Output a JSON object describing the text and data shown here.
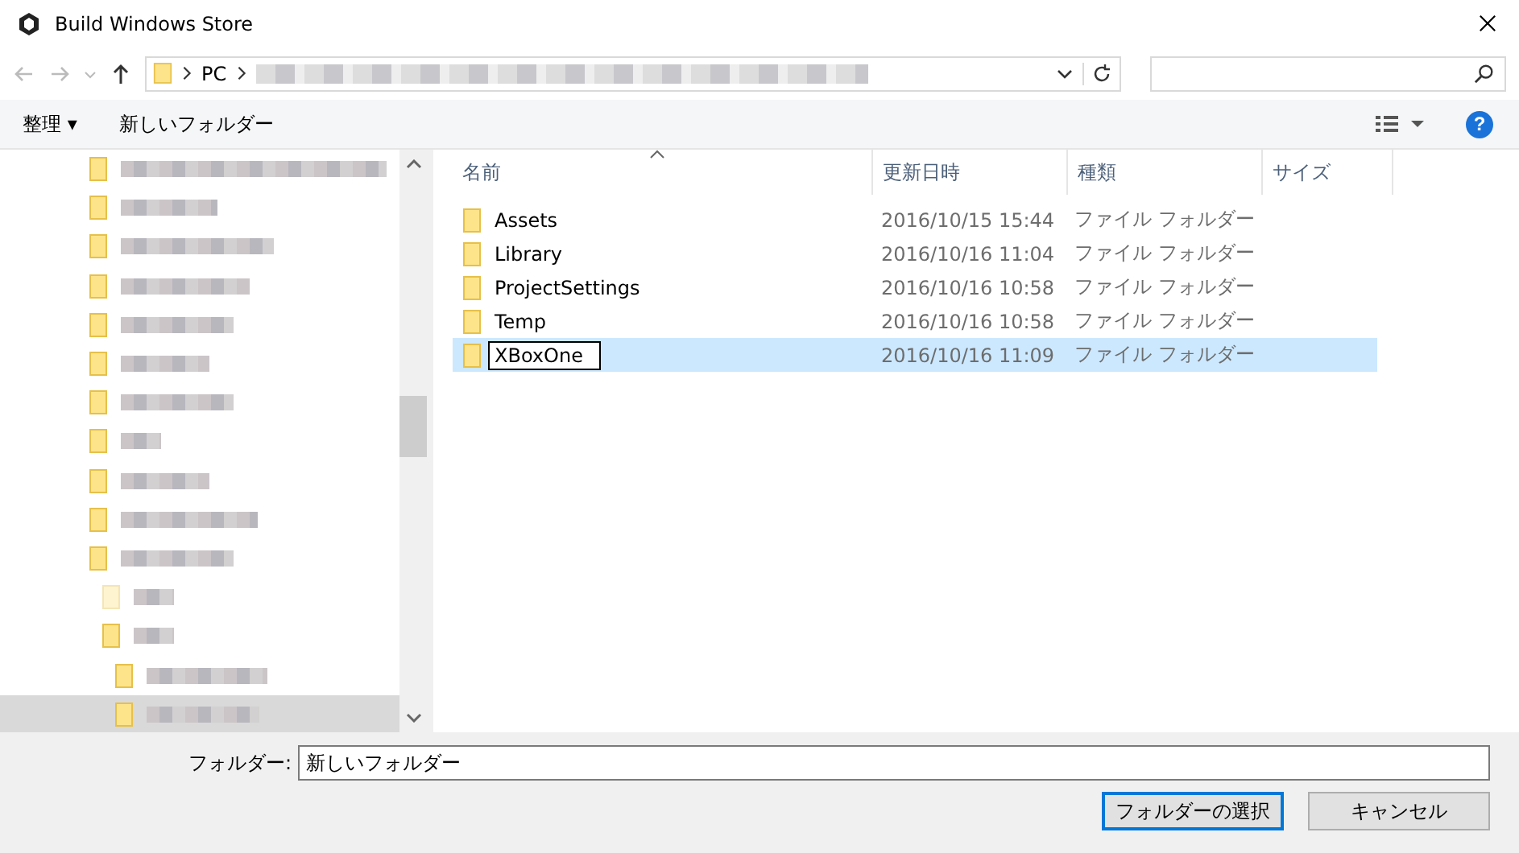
{
  "window": {
    "title": "Build Windows Store"
  },
  "address": {
    "segments": [
      "PC"
    ]
  },
  "toolbar": {
    "organize": "整理 ▾",
    "new_folder": "新しいフォルダー",
    "help": "?"
  },
  "tree": [
    {
      "selected": false,
      "dimmed": false
    },
    {
      "selected": false,
      "dimmed": false
    },
    {
      "selected": false,
      "dimmed": false
    },
    {
      "selected": false,
      "dimmed": false
    },
    {
      "selected": false,
      "dimmed": false
    },
    {
      "selected": false,
      "dimmed": false
    },
    {
      "selected": false,
      "dimmed": false
    },
    {
      "selected": false,
      "dimmed": false
    },
    {
      "selected": false,
      "dimmed": false
    },
    {
      "selected": false,
      "dimmed": false
    },
    {
      "selected": false,
      "dimmed": false,
      "children": [
        {
          "selected": false,
          "dimmed": true
        },
        {
          "selected": false,
          "dimmed": false,
          "children": [
            {
              "selected": false,
              "dimmed": false
            },
            {
              "selected": true,
              "dimmed": false
            }
          ]
        }
      ]
    }
  ],
  "table": {
    "columns": [
      "名前",
      "更新日時",
      "種類",
      "サイズ"
    ],
    "rows": [
      {
        "name": "Assets",
        "date": "2016/10/15 15:44",
        "type": "ファイル フォルダー",
        "selected": false,
        "editing": false
      },
      {
        "name": "Library",
        "date": "2016/10/16 11:04",
        "type": "ファイル フォルダー",
        "selected": false,
        "editing": false
      },
      {
        "name": "ProjectSettings",
        "date": "2016/10/16 10:58",
        "type": "ファイル フォルダー",
        "selected": false,
        "editing": false
      },
      {
        "name": "Temp",
        "date": "2016/10/16 10:58",
        "type": "ファイル フォルダー",
        "selected": false,
        "editing": false
      },
      {
        "name": "XBoxOne",
        "date": "2016/10/16 11:09",
        "type": "ファイル フォルダー",
        "selected": true,
        "editing": true
      }
    ]
  },
  "footer": {
    "folder_label": "フォルダー:",
    "folder_value": "新しいフォルダー",
    "buttons": [
      {
        "label": "フォルダーの選択",
        "kind": "primary"
      },
      {
        "label": "キャンセル",
        "kind": "normal"
      }
    ]
  }
}
